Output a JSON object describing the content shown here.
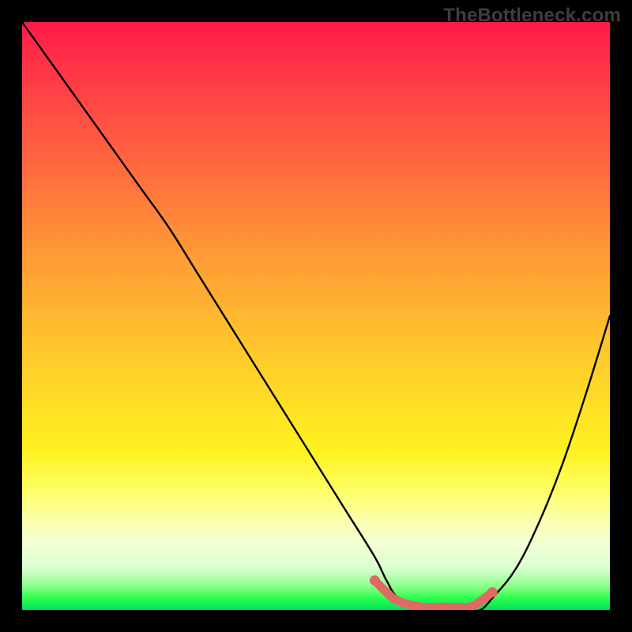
{
  "watermark": "TheBottleneck.com",
  "chart_data": {
    "type": "line",
    "title": "",
    "xlabel": "",
    "ylabel": "",
    "xlim": [
      0,
      100
    ],
    "ylim": [
      0,
      100
    ],
    "grid": false,
    "legend": false,
    "series": [
      {
        "name": "bottleneck-curve",
        "color": "#000000",
        "x": [
          0,
          5,
          10,
          15,
          20,
          25,
          30,
          35,
          40,
          45,
          50,
          55,
          60,
          62,
          64,
          68,
          72,
          76,
          78,
          80,
          84,
          88,
          92,
          96,
          100
        ],
        "values": [
          100,
          93,
          86,
          79,
          72,
          65,
          57,
          49,
          41,
          33,
          25,
          17,
          9,
          5,
          2,
          0,
          0,
          0,
          0,
          2,
          7,
          15,
          25,
          37,
          50
        ]
      }
    ],
    "highlight_segment": {
      "color": "#e06964",
      "x": [
        60,
        62,
        64,
        68,
        72,
        76,
        78,
        80
      ],
      "values": [
        5,
        3,
        1.5,
        0.5,
        0.5,
        0.5,
        1.5,
        3
      ]
    },
    "gradient_stops": [
      {
        "pos": 0.0,
        "color": "#ff1a4a"
      },
      {
        "pos": 0.22,
        "color": "#ff6140"
      },
      {
        "pos": 0.5,
        "color": "#ffb830"
      },
      {
        "pos": 0.73,
        "color": "#fff21f"
      },
      {
        "pos": 0.85,
        "color": "#fbffb0"
      },
      {
        "pos": 0.96,
        "color": "#8cff89"
      },
      {
        "pos": 1.0,
        "color": "#00e35a"
      }
    ]
  }
}
